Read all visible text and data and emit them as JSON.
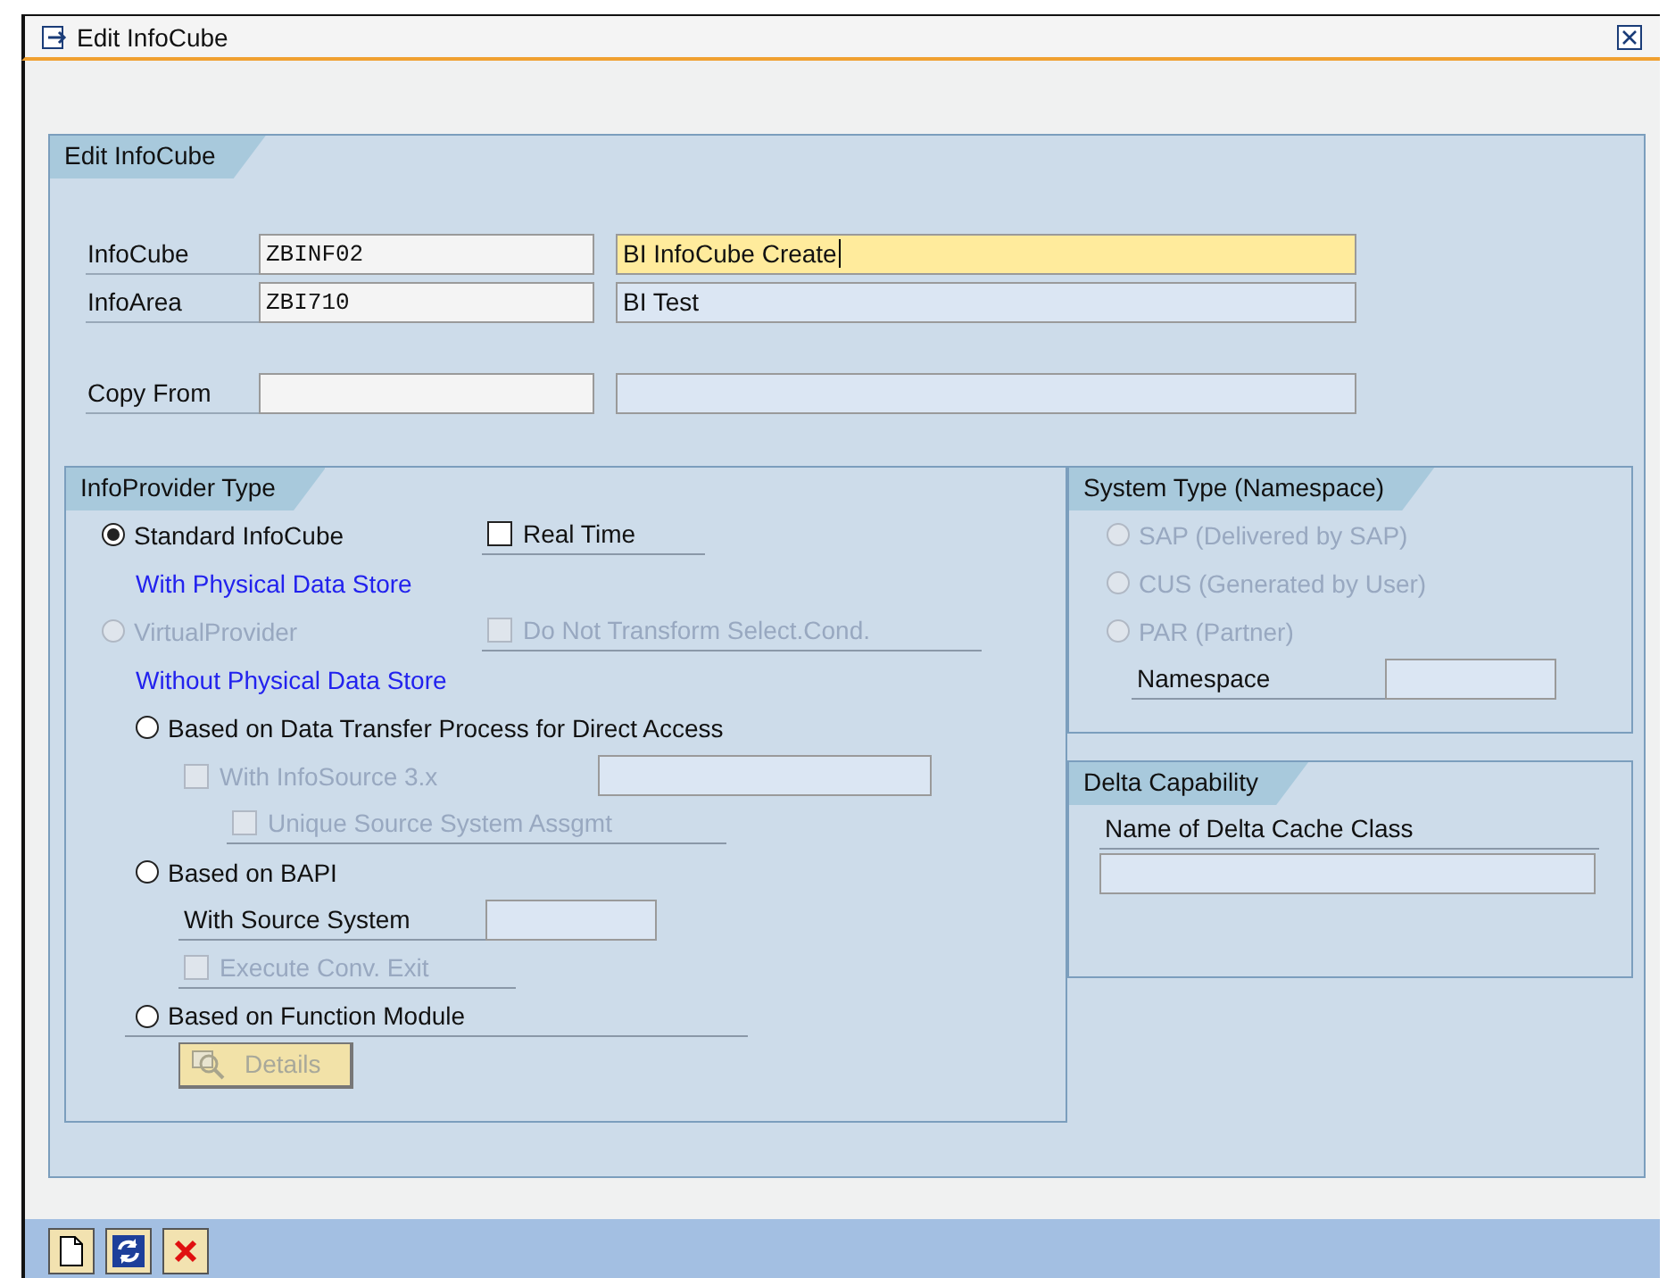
{
  "window": {
    "title": "Edit InfoCube"
  },
  "group": {
    "title": "Edit InfoCube"
  },
  "fields": [
    {
      "label": "InfoCube",
      "code": "ZBINF02",
      "description": "BI InfoCube Create",
      "focused": true
    },
    {
      "label": "InfoArea",
      "code": "ZBI710",
      "description": "BI Test",
      "focused": false
    },
    {
      "label": "Copy From",
      "focused": false
    }
  ],
  "infoprovider": {
    "title": "InfoProvider Type",
    "standard": {
      "label": "Standard InfoCube",
      "selected": true,
      "disabled": false,
      "note": "With Physical Data Store",
      "real_time": {
        "label": "Real Time",
        "checked": false,
        "disabled": false
      }
    },
    "virtual": {
      "label": "VirtualProvider",
      "selected": false,
      "disabled": true,
      "note": "Without Physical Data Store",
      "no_transform": {
        "label": "Do Not Transform Select.Cond.",
        "checked": false,
        "disabled": true
      }
    },
    "dtp": {
      "label": "Based on Data Transfer Process for Direct Access",
      "selected": false,
      "disabled": false,
      "infosource": {
        "label": "With InfoSource 3.x",
        "checked": false,
        "disabled": true
      },
      "unique": {
        "label": "Unique Source System Assgmt",
        "checked": false,
        "disabled": true
      }
    },
    "bapi": {
      "label": "Based on BAPI",
      "selected": false,
      "disabled": false,
      "source_system": "With Source System",
      "conv_exit": {
        "label": "Execute Conv. Exit",
        "checked": false,
        "disabled": true
      }
    },
    "function_module": {
      "label": "Based on Function Module",
      "selected": false,
      "disabled": false,
      "details": {
        "label": "Details",
        "disabled": true
      }
    }
  },
  "system_type": {
    "title": "System Type (Namespace)",
    "options": [
      {
        "label": "SAP (Delivered by SAP)",
        "selected": false,
        "disabled": true
      },
      {
        "label": "CUS (Generated by User)",
        "selected": false,
        "disabled": true
      },
      {
        "label": "PAR (Partner)",
        "selected": false,
        "disabled": true
      }
    ],
    "namespace_label": "Namespace"
  },
  "delta": {
    "title": "Delta Capability",
    "label": "Name of Delta Cache Class"
  },
  "toolbar": [
    {
      "kind": "new"
    },
    {
      "kind": "refresh"
    },
    {
      "kind": "cancel"
    }
  ]
}
